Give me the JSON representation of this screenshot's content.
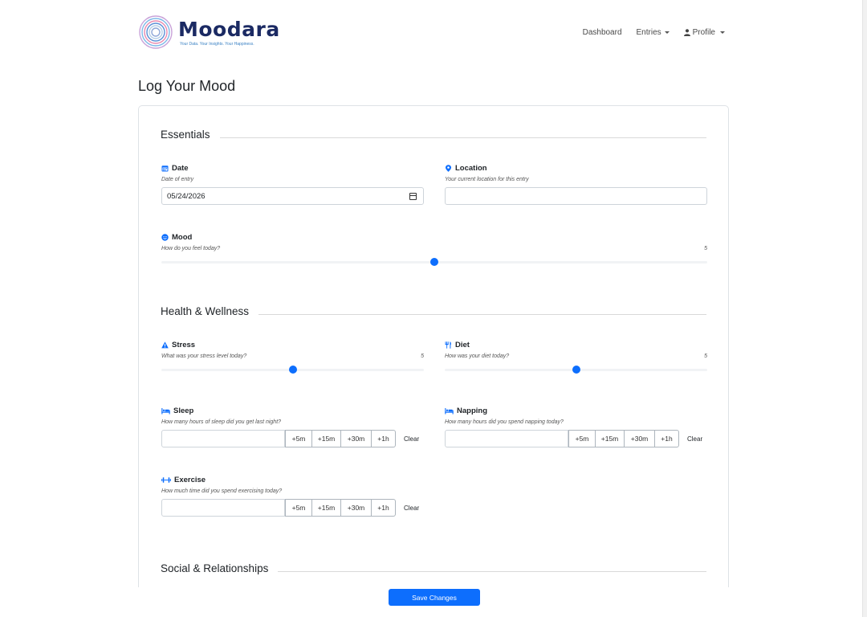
{
  "brand": {
    "name": "Moodara",
    "tagline": "Your Data. Your Insights. Your Happiness."
  },
  "nav": {
    "dashboard": "Dashboard",
    "entries": "Entries",
    "profile": "Profile"
  },
  "page": {
    "title": "Log Your Mood"
  },
  "sections": {
    "essentials": "Essentials",
    "health": "Health & Wellness",
    "social": "Social & Relationships"
  },
  "fields": {
    "date": {
      "label": "Date",
      "help": "Date of entry",
      "value": "05/24/2026",
      "icon": "calendar-icon"
    },
    "location": {
      "label": "Location",
      "help": "Your current location for this entry",
      "value": "",
      "icon": "map-pin-icon"
    },
    "mood": {
      "label": "Mood",
      "help": "How do you feel today?",
      "value": "5",
      "level": 0.5,
      "icon": "smile-icon"
    },
    "stress": {
      "label": "Stress",
      "help": "What was your stress level today?",
      "value": "5",
      "level": 0.5,
      "icon": "warning-icon"
    },
    "diet": {
      "label": "Diet",
      "help": "How was your diet today?",
      "value": "5",
      "level": 0.5,
      "icon": "utensils-icon"
    },
    "sleep": {
      "label": "Sleep",
      "help": "How many hours of sleep did you get last night?",
      "icon": "bed-icon"
    },
    "napping": {
      "label": "Napping",
      "help": "How many hours did you spend napping today?",
      "icon": "bed-icon"
    },
    "exercise": {
      "label": "Exercise",
      "help": "How much time did you spend exercising today?",
      "icon": "dumbbell-icon"
    }
  },
  "duration_buttons": {
    "b5m": "+5m",
    "b15m": "+15m",
    "b30m": "+30m",
    "b1h": "+1h",
    "clear": "Clear"
  },
  "actions": {
    "save": "Save Changes"
  },
  "colors": {
    "accent": "#0d6efd",
    "brand": "#1b2a63"
  }
}
